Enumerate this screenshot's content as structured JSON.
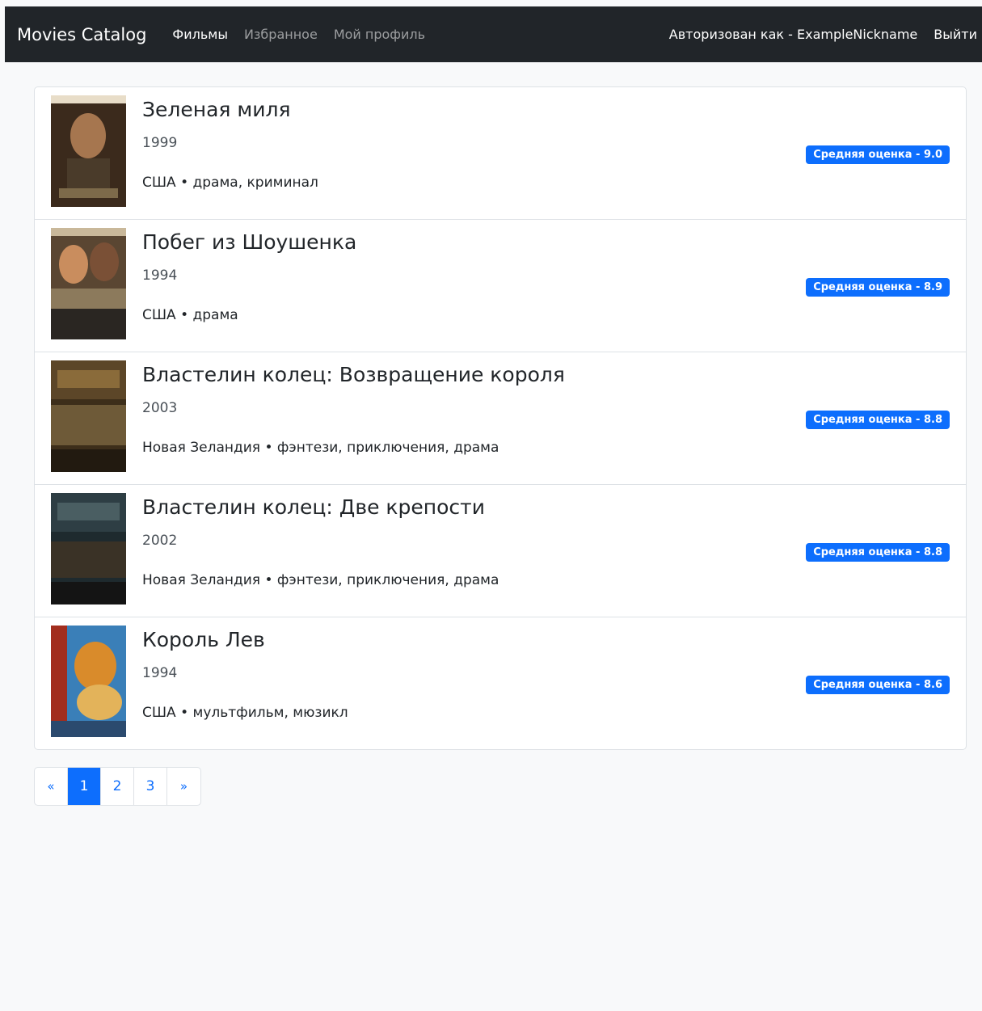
{
  "navbar": {
    "brand": "Movies Catalog",
    "links": [
      "Фильмы",
      "Избранное",
      "Мой профиль"
    ],
    "user_info": "Авторизован как - ExampleNickname",
    "logout": "Выйти"
  },
  "movies": [
    {
      "title": "Зеленая миля",
      "year": "1999",
      "meta": "США • драма, криминал",
      "rating": "Средняя оценка - 9.0"
    },
    {
      "title": "Побег из Шоушенка",
      "year": "1994",
      "meta": "США • драма",
      "rating": "Средняя оценка - 8.9"
    },
    {
      "title": "Властелин колец: Возвращение короля",
      "year": "2003",
      "meta": "Новая Зеландия • фэнтези, приключения, драма",
      "rating": "Средняя оценка - 8.8"
    },
    {
      "title": "Властелин колец: Две крепости",
      "year": "2002",
      "meta": "Новая Зеландия • фэнтези, приключения, драма",
      "rating": "Средняя оценка - 8.8"
    },
    {
      "title": "Король Лев",
      "year": "1994",
      "meta": "США • мультфильм, мюзикл",
      "rating": "Средняя оценка - 8.6"
    }
  ],
  "pagination": {
    "prev": "«",
    "pages": [
      "1",
      "2",
      "3"
    ],
    "next": "»",
    "active": "1"
  },
  "colors": {
    "navbar_bg": "#212529",
    "accent": "#0d6efd",
    "page_bg": "#f8f9fa"
  }
}
